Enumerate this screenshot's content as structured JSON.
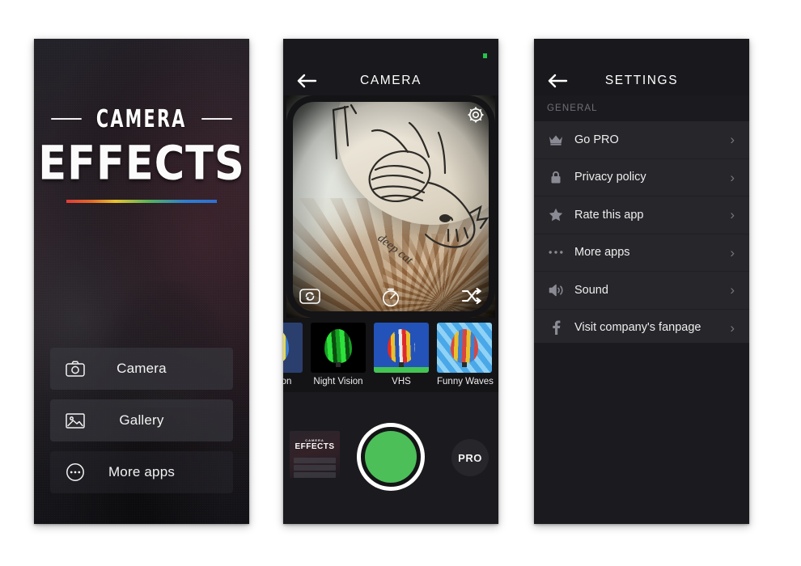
{
  "app": {
    "logo_top": "CAMERA",
    "logo_main": "EFFECTS"
  },
  "home": {
    "buttons": [
      {
        "label": "Camera",
        "icon": "camera-icon"
      },
      {
        "label": "Gallery",
        "icon": "image-icon"
      },
      {
        "label": "More apps",
        "icon": "ellipsis-circle-icon"
      }
    ]
  },
  "camera": {
    "title": "CAMERA",
    "back_icon": "back-arrow-icon",
    "status_dot_color": "#25c44a",
    "viewport": {
      "settings_icon": "gear-icon",
      "controls": [
        {
          "name": "switch-camera-icon"
        },
        {
          "name": "timer-icon"
        },
        {
          "name": "shuffle-icon"
        }
      ]
    },
    "filters": [
      {
        "label": "Cartoon",
        "selected": false,
        "bg": "#2b3f6e",
        "balloon": "#b94a4a"
      },
      {
        "label": "Night Vision",
        "selected": false,
        "bg": "#000000",
        "balloon": "#2ee03c"
      },
      {
        "label": "VHS",
        "selected": true,
        "bg": "#2353b8",
        "balloon": "#e8c22c"
      },
      {
        "label": "Funny Waves",
        "selected": false,
        "bg": "#4aa8e8",
        "balloon": "#d8473f"
      }
    ],
    "selected_indicator_color": "#43c453",
    "shutter": {
      "name": "shutter-button",
      "color": "#4cbf59"
    },
    "pro_label": "PRO",
    "gallery_preview": {
      "name": "gallery-preview-thumbnail",
      "logo_top": "CAMERA",
      "logo_main": "EFFECTS"
    }
  },
  "settings": {
    "title": "SETTINGS",
    "back_icon": "back-arrow-icon",
    "section_general": "GENERAL",
    "items": [
      {
        "label": "Go PRO",
        "icon": "crown-icon"
      },
      {
        "label": "Privacy policy",
        "icon": "lock-icon"
      },
      {
        "label": "Rate this app",
        "icon": "star-icon"
      },
      {
        "label": "More apps",
        "icon": "ellipsis-icon"
      },
      {
        "label": "Sound",
        "icon": "speaker-icon"
      },
      {
        "label": "Visit company's fanpage",
        "icon": "facebook-icon"
      }
    ],
    "chevron": "›"
  }
}
